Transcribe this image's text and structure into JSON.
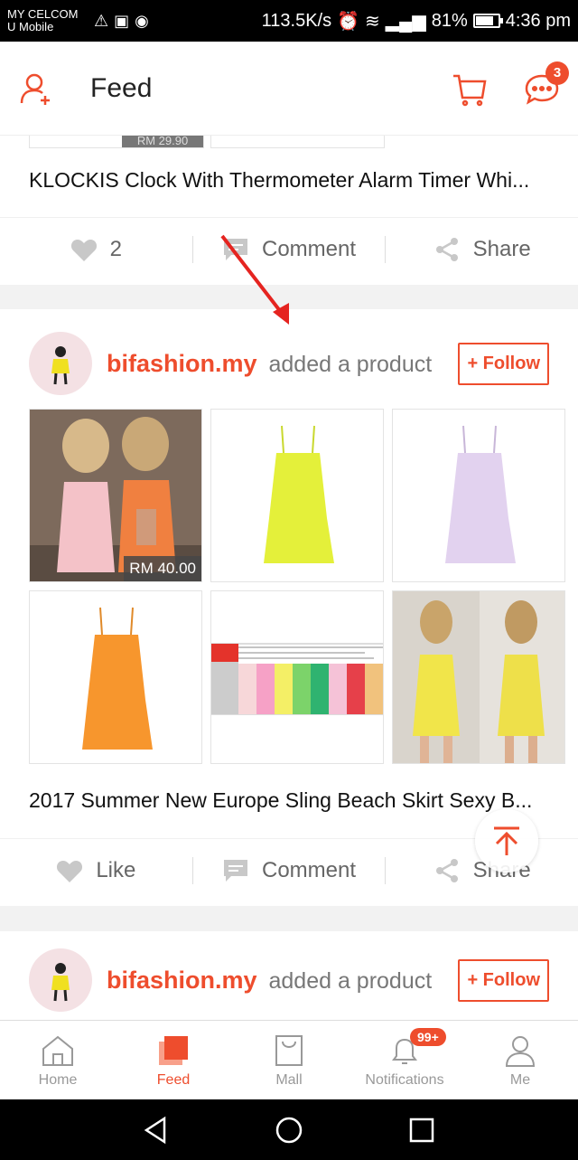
{
  "status": {
    "carrier1": "MY CELCOM",
    "carrier2": "U Mobile",
    "speed": "113.5K/s",
    "battery": "81%",
    "battery_level": 0.81,
    "time": "4:36 pm"
  },
  "header": {
    "title": "Feed",
    "chat_badge": "3"
  },
  "feed": {
    "card1": {
      "price_partial": "RM 29.90",
      "title": "KLOCKIS Clock With Thermometer Alarm Timer Whi...",
      "like_count": "2",
      "comment_label": "Comment",
      "share_label": "Share"
    },
    "card2": {
      "shop_name": "bifashion.my",
      "action_text": "added a product",
      "follow_label": "+ Follow",
      "price": "RM 40.00",
      "title": "2017 Summer New Europe Sling Beach Skirt Sexy B...",
      "like_label": "Like",
      "comment_label": "Comment",
      "share_label": "Share"
    },
    "card3": {
      "shop_name": "bifashion.my",
      "action_text": "added a product",
      "follow_label": "+ Follow"
    }
  },
  "nav": {
    "items": [
      {
        "label": "Home"
      },
      {
        "label": "Feed"
      },
      {
        "label": "Mall"
      },
      {
        "label": "Notifications"
      },
      {
        "label": "Me"
      }
    ],
    "notifications_badge": "99+"
  },
  "colors": {
    "accent": "#ee4d2d"
  }
}
